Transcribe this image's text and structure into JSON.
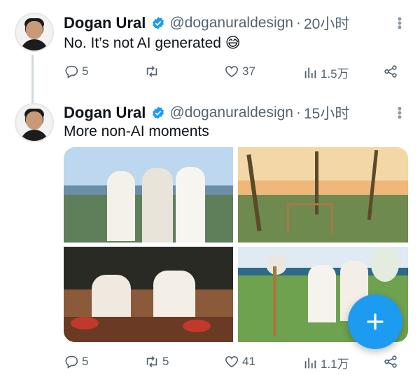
{
  "tweets": [
    {
      "name": "Dogan Ural",
      "handle": "@doganuraldesign",
      "separator": "·",
      "time": "20小时",
      "text": "No. It’s not AI generated 😅",
      "replies": "5",
      "retweets": "",
      "likes": "37",
      "views": "1.5万"
    },
    {
      "name": "Dogan Ural",
      "handle": "@doganuraldesign",
      "separator": "·",
      "time": "15小时",
      "text": "More non-AI moments",
      "replies": "5",
      "retweets": "5",
      "likes": "41",
      "views": "1.1万"
    }
  ],
  "colors": {
    "accent": "#1d9bf0",
    "secondary_text": "#536471",
    "primary_text": "#0f1419"
  },
  "icons": {
    "verified": "verified-badge-icon",
    "reply": "reply-icon",
    "retweet": "retweet-icon",
    "like": "heart-icon",
    "views": "views-bar-icon",
    "share": "share-icon",
    "more": "more-vertical-icon",
    "compose": "plus-icon"
  }
}
